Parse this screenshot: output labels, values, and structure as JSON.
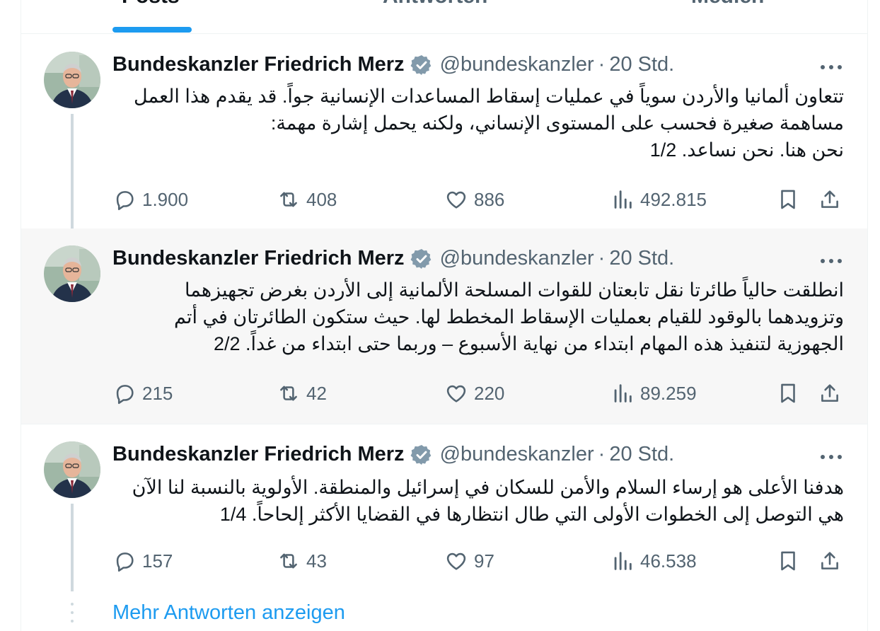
{
  "tabs": [
    {
      "label": "Posts",
      "active": true
    },
    {
      "label": "Antworten",
      "active": false
    },
    {
      "label": "Medien",
      "active": false
    }
  ],
  "tweets": [
    {
      "name": "Bundeskanzler Friedrich Merz",
      "handle": "@bundeskanzler",
      "separator": "·",
      "time": "20 Std.",
      "text": "تتعاون ألمانيا والأردن سوياً في عمليات إسقاط المساعدات الإنسانية جواً. قد يقدم هذا العمل\nمساهمة صغيرة فحسب على المستوى الإنساني، ولكنه يحمل إشارة مهمة:\nنحن هنا. نحن نساعد. 1/2",
      "replies": "1.900",
      "reposts": "408",
      "likes": "886",
      "views": "492.815"
    },
    {
      "name": "Bundeskanzler Friedrich Merz",
      "handle": "@bundeskanzler",
      "separator": "·",
      "time": "20 Std.",
      "text": "انطلقت حالياً طائرتا نقل تابعتان للقوات المسلحة الألمانية إلى الأردن بغرض تجهيزهما\nوتزويدهما بالوقود للقيام بعمليات الإسقاط المخطط لها. حيث ستكون الطائرتان في أتم\nالجهوزية لتنفيذ هذه المهام ابتداء من نهاية الأسبوع – وربما حتى ابتداء من غداً. 2/2",
      "replies": "215",
      "reposts": "42",
      "likes": "220",
      "views": "89.259"
    },
    {
      "name": "Bundeskanzler Friedrich Merz",
      "handle": "@bundeskanzler",
      "separator": "·",
      "time": "20 Std.",
      "text": "هدفنا الأعلى هو إرساء السلام والأمن للسكان في إسرائيل والمنطقة. الأولوية بالنسبة لنا الآن\nهي التوصل إلى الخطوات الأولى التي طال انتظارها في القضايا الأكثر إلحاحاً. 1/4",
      "replies": "157",
      "reposts": "43",
      "likes": "97",
      "views": "46.538"
    }
  ],
  "show_more_label": "Mehr Antworten anzeigen",
  "colors": {
    "accent": "#1d9bf0",
    "secondary_text": "#536471",
    "verified_badge": "#829aab",
    "highlight_bg": "#f7f7f7"
  },
  "icons": [
    "verified-badge-icon",
    "more-icon",
    "reply-icon",
    "repost-icon",
    "like-icon",
    "views-icon",
    "bookmark-icon",
    "share-icon"
  ]
}
